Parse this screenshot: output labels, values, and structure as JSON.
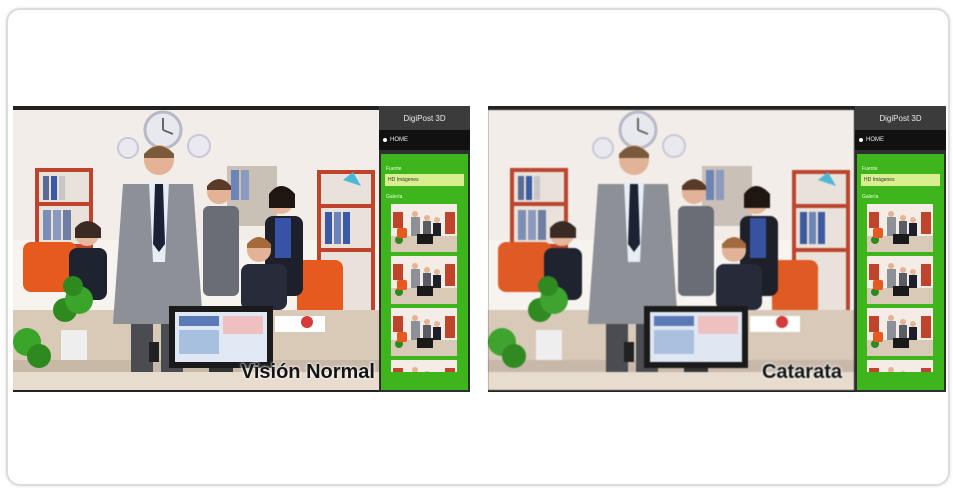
{
  "panels": [
    {
      "caption": "Visión Normal",
      "sidebar": {
        "title": "DigiPost 3D",
        "nav_label": "HOME",
        "field_label": "Fuente",
        "select_value": "HD Imágenes",
        "gallery_label": "Galería"
      }
    },
    {
      "caption": "Catarata",
      "sidebar": {
        "title": "DigiPost 3D",
        "nav_label": "HOME",
        "field_label": "Fuente",
        "select_value": "HD Imágenes",
        "gallery_label": "Galería"
      }
    }
  ],
  "colors": {
    "sidebar_green": "#3fb51d",
    "select_fill": "#d8ef8f",
    "frame_dark": "#222222"
  }
}
